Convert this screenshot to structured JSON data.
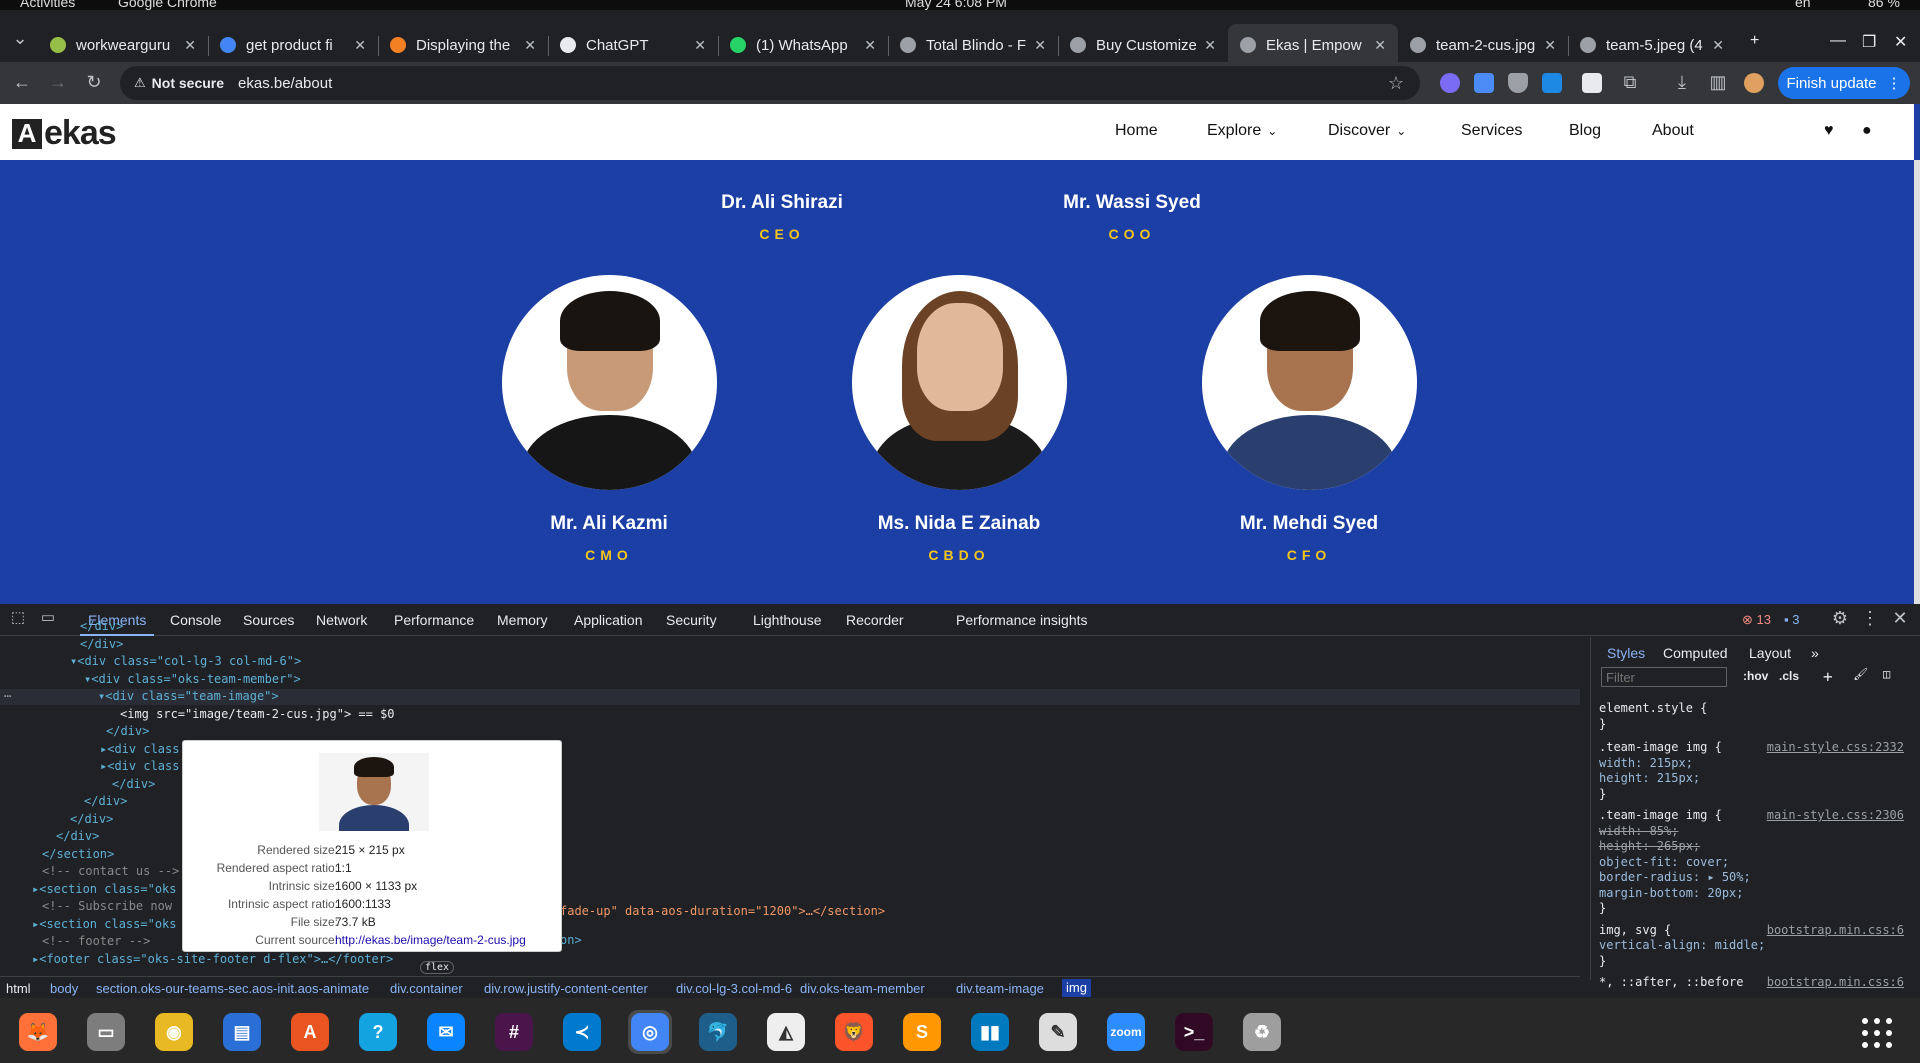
{
  "system_bar": {
    "activities": "Activities",
    "app": "Google Chrome",
    "clock": "May 24  6:08 PM",
    "lang": "en",
    "battery": "86 %"
  },
  "tabs": [
    {
      "title": "workwearguru",
      "color": "#95bf47"
    },
    {
      "title": "get product fi",
      "color": "#4285f4"
    },
    {
      "title": "Displaying the",
      "color": "#f48024"
    },
    {
      "title": "ChatGPT",
      "color": "#e8eaed"
    },
    {
      "title": "(1) WhatsApp",
      "color": "#25d366"
    },
    {
      "title": "Total Blindo - F",
      "color": "#9aa0a6"
    },
    {
      "title": "Buy Customize",
      "color": "#9aa0a6"
    },
    {
      "title": "Ekas | Empow",
      "color": "#9aa0a6"
    },
    {
      "title": "team-2-cus.jpg",
      "color": "#9aa0a6"
    },
    {
      "title": "team-5.jpeg (4",
      "color": "#9aa0a6"
    }
  ],
  "address_bar": {
    "security": "Not secure",
    "url": "ekas.be/about"
  },
  "finish_update": "Finish update",
  "site": {
    "logo_text": "ekas",
    "nav": [
      {
        "label": "Home",
        "chevron": false
      },
      {
        "label": "Explore",
        "chevron": true
      },
      {
        "label": "Discover",
        "chevron": true
      },
      {
        "label": "Services",
        "chevron": false
      },
      {
        "label": "Blog",
        "chevron": false
      },
      {
        "label": "About",
        "chevron": false
      }
    ],
    "team_row1": [
      {
        "name": "Dr. Ali Shirazi",
        "role": "CEO"
      },
      {
        "name": "Mr. Wassi Syed",
        "role": "COO"
      }
    ],
    "team_row2": [
      {
        "name": "Mr. Ali Kazmi",
        "role": "CMO",
        "skin": "#c99a78",
        "hair": "#1a1410",
        "body": "#161616"
      },
      {
        "name": "Ms. Nida E Zainab",
        "role": "CBDO",
        "skin": "#e2b89a",
        "hair": "#6b4226",
        "body": "#1b1b1b"
      },
      {
        "name": "Mr. Mehdi Syed",
        "role": "CFO",
        "skin": "#a8744f",
        "hair": "#1c140e",
        "body": "#2b3f6e"
      }
    ]
  },
  "devtools": {
    "tabs": [
      "Elements",
      "Console",
      "Sources",
      "Network",
      "Performance",
      "Memory",
      "Application",
      "Security",
      "Lighthouse",
      "Recorder",
      "Performance insights"
    ],
    "errors": "13",
    "messages": "3",
    "code_lines": [
      {
        "t": "</div>",
        "k": "tag"
      },
      {
        "t": "</div>",
        "k": "tag"
      },
      {
        "t": "▾<div class=\"col-lg-3 col-md-6\">",
        "k": "tag"
      },
      {
        "t": "▾<div class=\"oks-team-member\">",
        "k": "tag"
      },
      {
        "t": "▾<div class=\"team-image\">",
        "k": "tag"
      },
      {
        "t": "<img src=\"image/team-2-cus.jpg\"> == $0",
        "k": "sel"
      },
      {
        "t": "</div>",
        "k": "tag"
      },
      {
        "t": "▸<div class",
        "k": "tag"
      },
      {
        "t": "▸<div class",
        "k": "tag"
      },
      {
        "t": "</div>",
        "k": "tag"
      },
      {
        "t": "</div>",
        "k": "tag"
      },
      {
        "t": "</div>",
        "k": "tag"
      },
      {
        "t": "</div>",
        "k": "tag"
      },
      {
        "t": "</section>",
        "k": "tag"
      },
      {
        "t": "<!-- contact us -->",
        "k": "comment"
      },
      {
        "t": "▸<section class=\"oks",
        "k": "tag"
      },
      {
        "t": "<!-- Subscribe now",
        "k": "comment"
      },
      {
        "t": "▸<section class=\"oks",
        "k": "tag"
      },
      {
        "t": "<!-- footer -->",
        "k": "comment"
      },
      {
        "t": "▸<footer class=\"oks-site-footer d-flex\">…</footer>",
        "k": "tag"
      }
    ],
    "code_tail_1": "fade-up\" data-aos-duration=\"1200\">…</section>",
    "code_tail_2": "on>",
    "flex_badge": "flex",
    "tooltip": {
      "rows": [
        {
          "k": "Rendered size:",
          "v": "215 × 215 px"
        },
        {
          "k": "Rendered aspect ratio:",
          "v": "1:1"
        },
        {
          "k": "Intrinsic size:",
          "v": "1600 × 1133 px"
        },
        {
          "k": "Intrinsic aspect ratio:",
          "v": "1600:1133"
        },
        {
          "k": "File size:",
          "v": "73.7 kB"
        },
        {
          "k": "Current source:",
          "v": "http://ekas.be/image/team-2-cus.jpg"
        }
      ]
    },
    "styles_tabs": [
      "Styles",
      "Computed",
      "Layout"
    ],
    "filter_placeholder": "Filter",
    "hov": ":hov",
    "cls": ".cls",
    "style_lines": [
      {
        "t": "element.style {",
        "src": ""
      },
      {
        "t": "}",
        "src": ""
      },
      {
        "t": ".team-image img {",
        "src": "main-style.css:2332"
      },
      {
        "t": "  width: 215px;",
        "src": ""
      },
      {
        "t": "  height: 215px;",
        "src": ""
      },
      {
        "t": "}",
        "src": ""
      },
      {
        "t": ".team-image img {",
        "src": "main-style.css:2306"
      },
      {
        "t": "  width: 85%;",
        "src": "",
        "strike": true
      },
      {
        "t": "  height: 265px;",
        "src": "",
        "strike": true
      },
      {
        "t": "  object-fit: cover;",
        "src": ""
      },
      {
        "t": "  border-radius: ▸ 50%;",
        "src": ""
      },
      {
        "t": "  margin-bottom: 20px;",
        "src": ""
      },
      {
        "t": "}",
        "src": ""
      },
      {
        "t": "img, svg {",
        "src": "bootstrap.min.css:6"
      },
      {
        "t": "  vertical-align: middle;",
        "src": ""
      },
      {
        "t": "}",
        "src": ""
      },
      {
        "t": "*, ::after, ::before",
        "src": "bootstrap.min.css:6"
      }
    ],
    "breadcrumbs": [
      "html",
      "body",
      "section.oks-our-teams-sec.aos-init.aos-animate",
      "div.container",
      "div.row.justify-content-center",
      "div.col-lg-3.col-md-6",
      "div.oks-team-member",
      "div.team-image",
      "img"
    ]
  },
  "dock": [
    {
      "name": "firefox",
      "color": "#ff7139",
      "glyph": "🦊"
    },
    {
      "name": "files",
      "color": "#7d7d7d",
      "glyph": "▭"
    },
    {
      "name": "rhythmbox",
      "color": "#e8b923",
      "glyph": "◉"
    },
    {
      "name": "writer",
      "color": "#2a6fd6",
      "glyph": "▤"
    },
    {
      "name": "app-center",
      "color": "#e95420",
      "glyph": "A"
    },
    {
      "name": "help",
      "color": "#12a3e0",
      "glyph": "?"
    },
    {
      "name": "thunderbird",
      "color": "#0a84ff",
      "glyph": "✉"
    },
    {
      "name": "slack",
      "color": "#4a154b",
      "glyph": "#"
    },
    {
      "name": "vscode",
      "color": "#007acc",
      "glyph": "≺"
    },
    {
      "name": "chrome",
      "color": "#4285f4",
      "glyph": "◎"
    },
    {
      "name": "mysql-workbench",
      "color": "#1d5f8a",
      "glyph": "🐬"
    },
    {
      "name": "inkscape",
      "color": "#eeeeee",
      "glyph": "◭"
    },
    {
      "name": "brave",
      "color": "#fb542b",
      "glyph": "🦁"
    },
    {
      "name": "sublime",
      "color": "#ff9800",
      "glyph": "S"
    },
    {
      "name": "trello",
      "color": "#0079bf",
      "glyph": "▮▮"
    },
    {
      "name": "text-editor",
      "color": "#dddddd",
      "glyph": "✎"
    },
    {
      "name": "zoom",
      "color": "#2d8cff",
      "glyph": "zoom"
    },
    {
      "name": "terminal",
      "color": "#300a24",
      "glyph": ">_"
    },
    {
      "name": "trash",
      "color": "#9e9e9e",
      "glyph": "♻"
    }
  ]
}
